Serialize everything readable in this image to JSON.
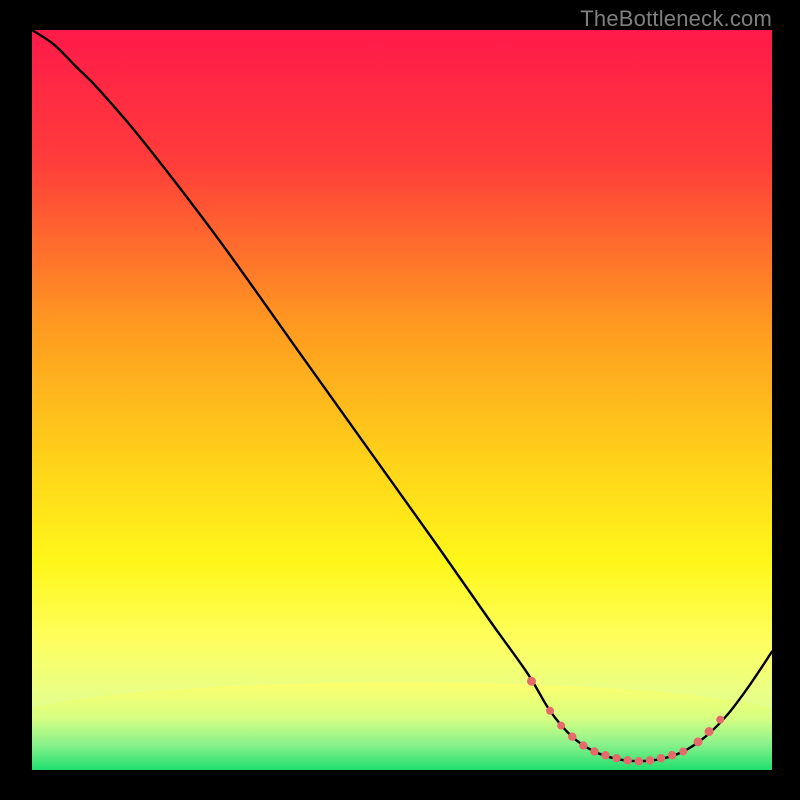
{
  "watermark": "TheBottleneck.com",
  "chart_data": {
    "type": "line",
    "xlim": [
      0,
      100
    ],
    "ylim": [
      0,
      100
    ],
    "title": "",
    "xlabel": "",
    "ylabel": "",
    "background_gradient_stops": [
      {
        "offset": 0.0,
        "color": "#ff1a4a"
      },
      {
        "offset": 0.18,
        "color": "#ff3d3a"
      },
      {
        "offset": 0.4,
        "color": "#ff9a20"
      },
      {
        "offset": 0.58,
        "color": "#ffd21a"
      },
      {
        "offset": 0.72,
        "color": "#fff71a"
      },
      {
        "offset": 0.83,
        "color": "#fdff62"
      },
      {
        "offset": 0.91,
        "color": "#e5ff8c"
      },
      {
        "offset": 0.955,
        "color": "#b8ff8c"
      },
      {
        "offset": 0.978,
        "color": "#70f78c"
      },
      {
        "offset": 1.0,
        "color": "#22e06e"
      }
    ],
    "cap_stops": [
      {
        "offset": 0.0,
        "color": "#feff6c"
      },
      {
        "offset": 0.4,
        "color": "#d8ff82"
      },
      {
        "offset": 0.7,
        "color": "#8cf28c"
      },
      {
        "offset": 1.0,
        "color": "#20df6e"
      }
    ],
    "curve": [
      {
        "x": 0,
        "y": 100
      },
      {
        "x": 3,
        "y": 98
      },
      {
        "x": 6,
        "y": 95
      },
      {
        "x": 9,
        "y": 92
      },
      {
        "x": 15,
        "y": 85
      },
      {
        "x": 25,
        "y": 72
      },
      {
        "x": 35,
        "y": 58
      },
      {
        "x": 45,
        "y": 44
      },
      {
        "x": 55,
        "y": 30
      },
      {
        "x": 62,
        "y": 20
      },
      {
        "x": 67,
        "y": 13
      },
      {
        "x": 70,
        "y": 8
      },
      {
        "x": 73,
        "y": 4.5
      },
      {
        "x": 76,
        "y": 2.5
      },
      {
        "x": 79,
        "y": 1.5
      },
      {
        "x": 82,
        "y": 1.2
      },
      {
        "x": 85,
        "y": 1.5
      },
      {
        "x": 88,
        "y": 2.5
      },
      {
        "x": 91,
        "y": 4.5
      },
      {
        "x": 94,
        "y": 7.5
      },
      {
        "x": 97,
        "y": 11.5
      },
      {
        "x": 100,
        "y": 16
      }
    ],
    "marker_color": "#e66a6a",
    "markers": [
      {
        "x": 67.5,
        "y": 12.0,
        "r": 4.5
      },
      {
        "x": 70.0,
        "y": 8.0,
        "r": 4.0
      },
      {
        "x": 71.5,
        "y": 6.0,
        "r": 4.0
      },
      {
        "x": 73.0,
        "y": 4.5,
        "r": 4.2
      },
      {
        "x": 74.5,
        "y": 3.3,
        "r": 4.2
      },
      {
        "x": 76.0,
        "y": 2.5,
        "r": 4.2
      },
      {
        "x": 77.5,
        "y": 2.0,
        "r": 4.2
      },
      {
        "x": 79.0,
        "y": 1.6,
        "r": 4.2
      },
      {
        "x": 80.5,
        "y": 1.3,
        "r": 4.2
      },
      {
        "x": 82.0,
        "y": 1.2,
        "r": 4.2
      },
      {
        "x": 83.5,
        "y": 1.3,
        "r": 4.2
      },
      {
        "x": 85.0,
        "y": 1.6,
        "r": 4.2
      },
      {
        "x": 86.5,
        "y": 2.0,
        "r": 4.2
      },
      {
        "x": 88.0,
        "y": 2.5,
        "r": 4.0
      },
      {
        "x": 90.0,
        "y": 3.8,
        "r": 4.5
      },
      {
        "x": 91.5,
        "y": 5.2,
        "r": 4.5
      },
      {
        "x": 93.0,
        "y": 6.8,
        "r": 4.0
      }
    ]
  }
}
